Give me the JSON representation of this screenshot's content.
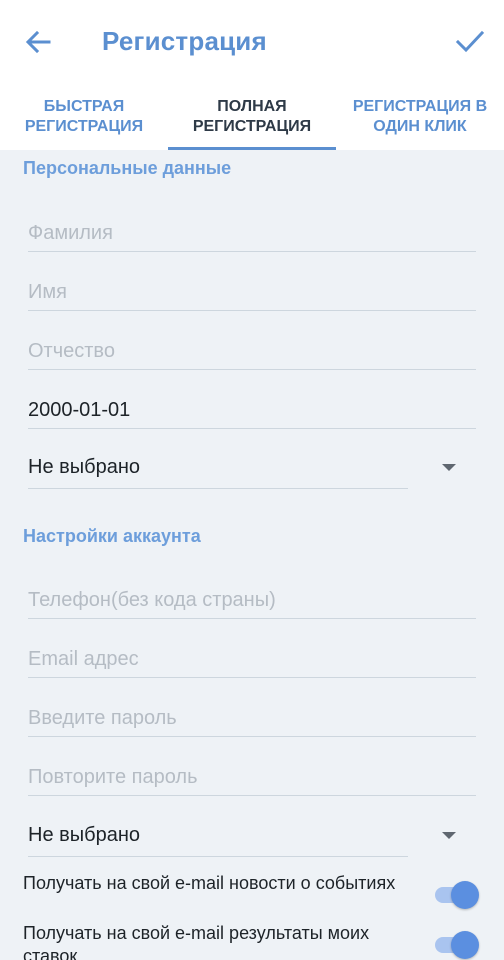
{
  "header": {
    "title": "Регистрация",
    "back_icon": "arrow-left-icon",
    "confirm_icon": "check-icon"
  },
  "tabs": [
    {
      "label": "БЫСТРАЯ РЕГИСТРАЦИЯ",
      "active": false
    },
    {
      "label": "ПОЛНАЯ РЕГИСТРАЦИЯ",
      "active": true
    },
    {
      "label": "РЕГИСТРАЦИЯ В ОДИН КЛИК",
      "active": false
    }
  ],
  "personal": {
    "title": "Персональные данные",
    "surname_placeholder": "Фамилия",
    "name_placeholder": "Имя",
    "patronymic_placeholder": "Отчество",
    "birthdate_value": "2000-01-01",
    "select_value": "Не выбрано"
  },
  "account": {
    "title": "Настройки аккаунта",
    "phone_placeholder": "Телефон(без кода страны)",
    "email_placeholder": "Email адрес",
    "password_placeholder": "Введите пароль",
    "password_repeat_placeholder": "Повторите пароль",
    "select_value": "Не выбрано"
  },
  "toggles": [
    {
      "label": "Получать на свой e-mail новости о событиях",
      "on": true
    },
    {
      "label": "Получать на свой e-mail результаты моих ставок",
      "on": true
    }
  ],
  "colors": {
    "accent": "#5b8fd0",
    "background": "#eef2f6"
  }
}
